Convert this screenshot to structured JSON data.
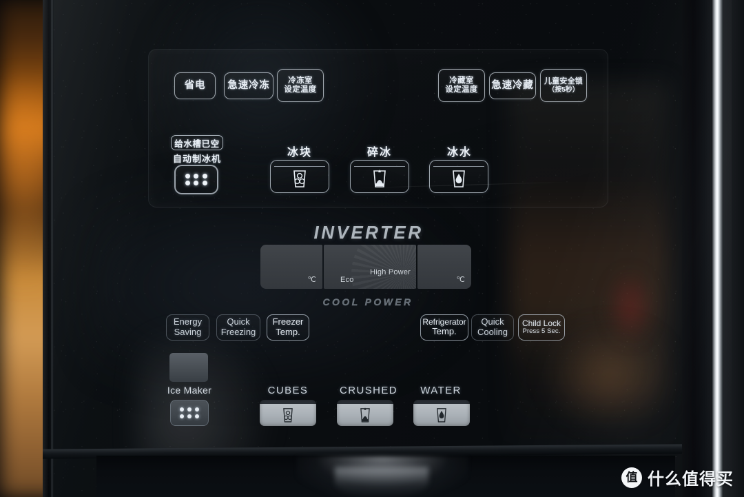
{
  "device": {
    "brand_mark": "INVERTER",
    "sub_mark": "COOL POWER"
  },
  "chinese_panel": {
    "top_row_left": [
      {
        "name": "energy-saving",
        "lines": [
          "省电"
        ]
      },
      {
        "name": "quick-freezing",
        "lines": [
          "急速冷冻"
        ]
      },
      {
        "name": "freezer-temp",
        "lines": [
          "冷冻室",
          "设定温度"
        ]
      }
    ],
    "top_row_right": [
      {
        "name": "refrigerator-temp",
        "lines": [
          "冷藏室",
          "设定温度"
        ]
      },
      {
        "name": "quick-cooling",
        "lines": [
          "急速冷藏"
        ]
      },
      {
        "name": "child-lock",
        "lines": [
          "儿童安全锁",
          "（按5秒）"
        ]
      }
    ],
    "ice_maker": {
      "tank_badge": "给水槽已空",
      "label": "自动制冰机"
    },
    "ice_options": [
      {
        "name": "cubes",
        "label": "冰块",
        "icon": "glass-ice-cubes-icon"
      },
      {
        "name": "crushed",
        "label": "碎冰",
        "icon": "glass-crushed-ice-icon"
      },
      {
        "name": "water",
        "label": "冰水",
        "icon": "glass-water-drop-icon"
      }
    ]
  },
  "display": {
    "left_unit": "℃",
    "right_unit": "℃",
    "mode_low": "Eco",
    "mode_high": "High Power"
  },
  "english_panel": {
    "row_left": [
      {
        "name": "energy-saving",
        "lines": [
          "Energy",
          "Saving"
        ],
        "sub": ""
      },
      {
        "name": "quick-freezing",
        "lines": [
          "Quick",
          "Freezing"
        ],
        "sub": ""
      },
      {
        "name": "freezer-temp",
        "lines": [
          "Freezer",
          "Temp."
        ],
        "sub": ""
      }
    ],
    "row_right": [
      {
        "name": "refrigerator-temp",
        "lines": [
          "Refrigerator",
          "Temp."
        ],
        "sub": ""
      },
      {
        "name": "quick-cooling",
        "lines": [
          "Quick",
          "Cooling"
        ],
        "sub": ""
      },
      {
        "name": "child-lock",
        "lines": [
          "Child Lock"
        ],
        "sub": "Press 5 Sec."
      }
    ],
    "ice_maker_label": "Ice Maker",
    "ice_options": [
      {
        "name": "cubes",
        "label": "CUBES",
        "icon": "glass-ice-cubes-icon"
      },
      {
        "name": "crushed",
        "label": "CRUSHED",
        "icon": "glass-crushed-ice-icon"
      },
      {
        "name": "water",
        "label": "WATER",
        "icon": "glass-water-drop-icon"
      }
    ]
  },
  "watermark": {
    "logo_char": "值",
    "text": "什么值得买"
  },
  "colors": {
    "panel_black": "#0a0d10",
    "outline_white": "#e6ecf2",
    "display_gray": "#3a3e43",
    "backlit_gray": "#c9d1d8",
    "chrome": "#e8ecef",
    "warm_bg": "#c9731a"
  }
}
